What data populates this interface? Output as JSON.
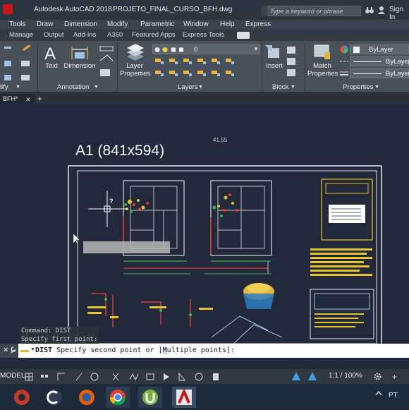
{
  "titlebar": {
    "app_title": "Autodesk AutoCAD 2018",
    "file_name": "PROJETO_FINAL_CURSO_BFH.dwg",
    "search_placeholder": "Type a keyword or phrase",
    "sign_in": "Sign In"
  },
  "menubar": [
    "Tools",
    "Draw",
    "Dimension",
    "Modify",
    "Parametric",
    "Window",
    "Help",
    "Express"
  ],
  "ribbon_tabs": [
    "Manage",
    "Output",
    "Add-ins",
    "A360",
    "Featured Apps",
    "Express Tools"
  ],
  "ribbon": {
    "text_label": "Text",
    "dimension_label": "Dimension",
    "layer_properties_label": "Layer\nProperties",
    "layer_current": "0",
    "insert_label": "Insert",
    "match_properties_label": "Match\nProperties",
    "bylayer_1": "ByLayer",
    "bylayer_2": "ByLayer",
    "bylayer_3": "ByLayer",
    "panels": {
      "modify": "lify",
      "annotation": "Annotation",
      "layers": "Layers",
      "block": "Block",
      "properties": "Properties"
    }
  },
  "doc_tab": "BFH*",
  "drawing": {
    "sheet_title": "A1 (841x594)",
    "dimension_text": "41.55",
    "cursor_text": "?"
  },
  "command": {
    "history_1": "Command: DIST",
    "history_2": "Specify first point:",
    "prefix": "DIST",
    "prompt_pre": "Specify second point or [",
    "option_hotkey": "M",
    "option_rest": "ultiple points",
    "prompt_post": "]:"
  },
  "statusbar": {
    "model": "MODEL",
    "scale": "1:1 / 100%"
  },
  "taskbar": {
    "lang": "PT"
  },
  "colors": {
    "background": "#21293a",
    "ribbon": "#48515a",
    "titlebar": "#2d3640",
    "accent_red": "#c7161c"
  }
}
